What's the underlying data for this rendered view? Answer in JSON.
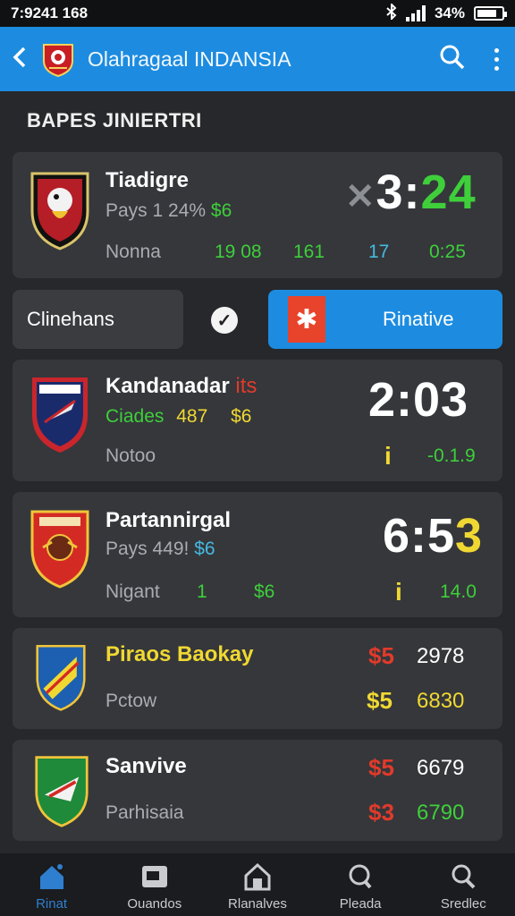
{
  "status_bar": {
    "time": "7:9241 168",
    "battery": "34%"
  },
  "app_bar": {
    "title": "Olahragaal INDANSIA",
    "back_icon": "back-arrow-icon",
    "search_icon": "search-icon",
    "menu_icon": "more-vert-icon"
  },
  "section": {
    "title": "BAPES JINIERTRI"
  },
  "matches": [
    {
      "team": "Tiadigre",
      "sub": "Pays 1 24%",
      "sub_extra": "$6",
      "score_a": "3:",
      "score_b": "24",
      "meta_label": "Nonna",
      "stats": [
        "19 08",
        "161",
        "17",
        "0:25"
      ]
    },
    {
      "team": "Kandanadar",
      "team_extra": "its",
      "sub": "Ciades",
      "sub_extra": "487",
      "sub_extra2": "$6",
      "score": "2:03",
      "meta_label": "Notoo",
      "marker": "i",
      "delta": "-0.1.9"
    },
    {
      "team": "Partannirgal",
      "sub": "Pays 449!",
      "sub_extra": "$6",
      "score_a": "6:5",
      "score_b": "3",
      "meta_label": "Nigant",
      "stat_a": "1",
      "stat_b": "$6",
      "marker": "i",
      "delta": "14.0"
    },
    {
      "team": "Piraos Baokay",
      "meta_label": "Pctow",
      "row1_price": "$5",
      "row1_value": "2978",
      "row2_price": "$5",
      "row2_value": "6830"
    },
    {
      "team": "Sanvive",
      "meta_label": "Parhisaia",
      "row1_price": "$5",
      "row1_value": "6679",
      "row2_price": "$3",
      "row2_value": "6790"
    }
  ],
  "filters": {
    "left_label": "Clinehans",
    "right_label": "Rinative"
  },
  "nav": [
    {
      "label": "Rinat",
      "icon": "home-icon"
    },
    {
      "label": "Ouandos",
      "icon": "gallery-icon"
    },
    {
      "label": "Rlanalves",
      "icon": "house-icon"
    },
    {
      "label": "Pleada",
      "icon": "chat-search-icon"
    },
    {
      "label": "Sredlec",
      "icon": "search-icon"
    }
  ],
  "colors": {
    "accent": "#1d8ce0",
    "card": "#35373b",
    "background": "#26282c",
    "green": "#3ecf3a",
    "yellow": "#f0d832",
    "red": "#e23a2a"
  }
}
